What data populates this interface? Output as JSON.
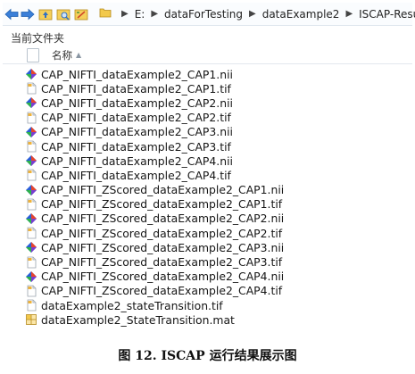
{
  "toolbar": {
    "back_icon": "back-arrow-icon",
    "forward_icon": "forward-arrow-icon",
    "colors": {
      "nav_arrow": "#3a7bd5",
      "folder": "#f2c94c"
    }
  },
  "address": {
    "drive": "E:",
    "crumbs": [
      "dataForTesting",
      "dataExample2",
      "ISCAP-Result"
    ]
  },
  "pane": {
    "title": "当前文件夹",
    "column_name": "名称"
  },
  "files": [
    {
      "name": "CAP_NIFTI_dataExample2_CAP1.nii",
      "icon": "nii"
    },
    {
      "name": "CAP_NIFTI_dataExample2_CAP1.tif",
      "icon": "tif"
    },
    {
      "name": "CAP_NIFTI_dataExample2_CAP2.nii",
      "icon": "nii"
    },
    {
      "name": "CAP_NIFTI_dataExample2_CAP2.tif",
      "icon": "tif"
    },
    {
      "name": "CAP_NIFTI_dataExample2_CAP3.nii",
      "icon": "nii"
    },
    {
      "name": "CAP_NIFTI_dataExample2_CAP3.tif",
      "icon": "tif"
    },
    {
      "name": "CAP_NIFTI_dataExample2_CAP4.nii",
      "icon": "nii"
    },
    {
      "name": "CAP_NIFTI_dataExample2_CAP4.tif",
      "icon": "tif"
    },
    {
      "name": "CAP_NIFTI_ZScored_dataExample2_CAP1.nii",
      "icon": "nii"
    },
    {
      "name": "CAP_NIFTI_ZScored_dataExample2_CAP1.tif",
      "icon": "tif"
    },
    {
      "name": "CAP_NIFTI_ZScored_dataExample2_CAP2.nii",
      "icon": "nii"
    },
    {
      "name": "CAP_NIFTI_ZScored_dataExample2_CAP2.tif",
      "icon": "tif"
    },
    {
      "name": "CAP_NIFTI_ZScored_dataExample2_CAP3.nii",
      "icon": "nii"
    },
    {
      "name": "CAP_NIFTI_ZScored_dataExample2_CAP3.tif",
      "icon": "tif"
    },
    {
      "name": "CAP_NIFTI_ZScored_dataExample2_CAP4.nii",
      "icon": "nii"
    },
    {
      "name": "CAP_NIFTI_ZScored_dataExample2_CAP4.tif",
      "icon": "tif"
    },
    {
      "name": "dataExample2_stateTransition.tif",
      "icon": "tif"
    },
    {
      "name": "dataExample2_StateTransition.mat",
      "icon": "mat"
    }
  ],
  "caption": "图 12. ISCAP 运行结果展示图"
}
